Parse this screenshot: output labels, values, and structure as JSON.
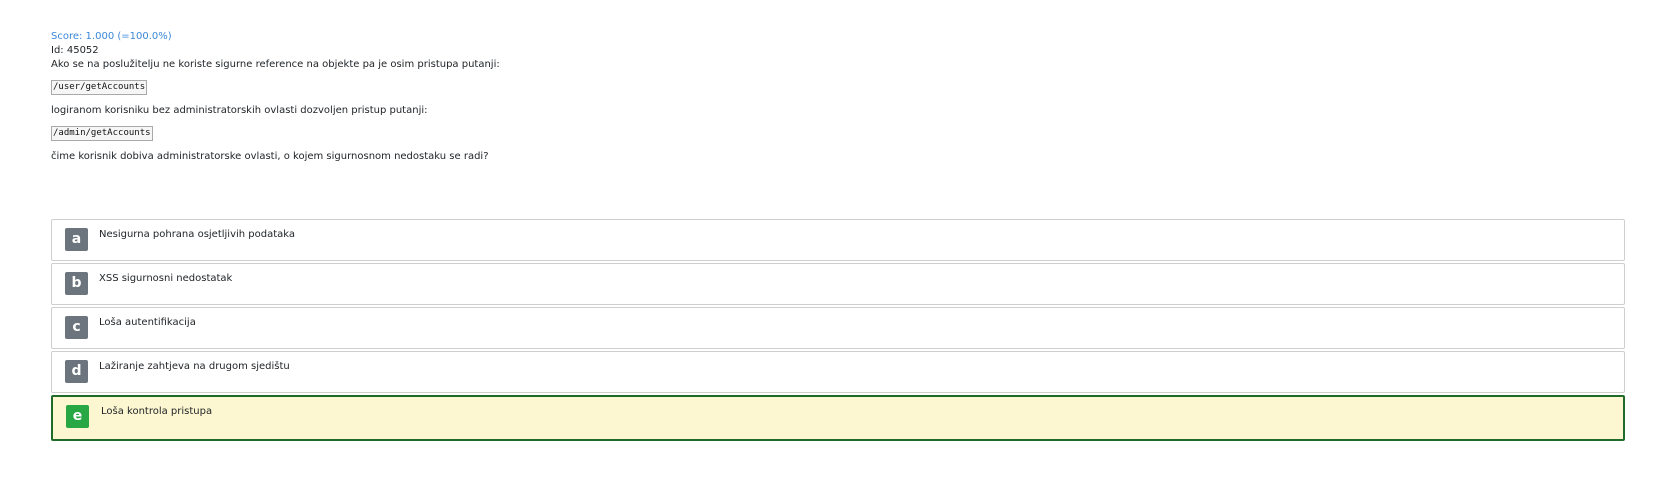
{
  "score_text": "Score: 1.000 (=100.0%)",
  "id_text": "Id: 45052",
  "question": {
    "line1": "Ako se na poslužitelju ne koriste sigurne reference na objekte pa je osim pristupa putanji:",
    "code1": "/user/getAccounts",
    "line2": "logiranom korisniku bez administratorskih ovlasti dozvoljen pristup putanji:",
    "code2": "/admin/getAccounts",
    "line3": "čime korisnik dobiva administratorske ovlasti, o kojem sigurnosnom nedostaku se radi?"
  },
  "answers": [
    {
      "letter": "a",
      "text": "Nesigurna pohrana osjetljivih podataka",
      "correct": false
    },
    {
      "letter": "b",
      "text": "XSS sigurnosni nedostatak",
      "correct": false
    },
    {
      "letter": "c",
      "text": "Loša autentifikacija",
      "correct": false
    },
    {
      "letter": "d",
      "text": "Lažiranje zahtjeva na drugom sjedištu",
      "correct": false
    },
    {
      "letter": "e",
      "text": "Loša kontrola pristupa",
      "correct": true
    }
  ],
  "colors": {
    "score": "#3a87d9",
    "letter_default": "#6c757d",
    "letter_correct": "#28a745",
    "correct_bg": "#fcf7d0",
    "correct_border": "#1f6b2a"
  }
}
